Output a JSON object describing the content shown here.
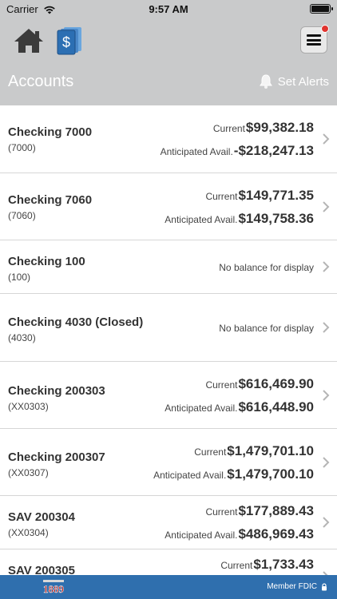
{
  "status": {
    "carrier": "Carrier",
    "time": "9:57 AM"
  },
  "header": {
    "title": "Accounts",
    "set_alerts": "Set Alerts"
  },
  "accounts": [
    {
      "name": "Checking 7000",
      "number": "(7000)",
      "current_label": "Current",
      "current": "$99,382.18",
      "avail_label": "Anticipated Avail.",
      "avail": "-$218,247.13"
    },
    {
      "name": "Checking 7060",
      "number": "(7060)",
      "current_label": "Current",
      "current": "$149,771.35",
      "avail_label": "Anticipated Avail.",
      "avail": "$149,758.36"
    },
    {
      "name": "Checking 100",
      "number": "(100)",
      "no_balance": "No balance for display"
    },
    {
      "name": "Checking 4030 (Closed)",
      "number": "(4030)",
      "no_balance": "No balance for display"
    },
    {
      "name": "Checking 200303",
      "number": "(XX0303)",
      "current_label": "Current",
      "current": "$616,469.90",
      "avail_label": "Anticipated Avail.",
      "avail": "$616,448.90"
    },
    {
      "name": "Checking 200307",
      "number": "(XX0307)",
      "current_label": "Current",
      "current": "$1,479,701.10",
      "avail_label": "Anticipated Avail.",
      "avail": "$1,479,700.10"
    },
    {
      "name": "SAV 200304",
      "number": "(XX0304)",
      "current_label": "Current",
      "current": "$177,889.43",
      "avail_label": "Anticipated Avail.",
      "avail": "$486,969.43"
    },
    {
      "name": "SAV 200305",
      "number": "",
      "current_label": "Current",
      "current": "$1,733.43"
    }
  ],
  "footer": {
    "logo_text": "1889",
    "member_fdic": "Member FDIC"
  },
  "colors": {
    "header_bg": "#c9cacb",
    "footer_bg": "#2f6fae",
    "notification": "#e0342f",
    "money_icon": "#2c6fb3"
  },
  "icons": [
    "home-icon",
    "money-icon",
    "menu-icon",
    "bell-icon",
    "chevron-right-icon",
    "lock-icon",
    "wifi-icon",
    "battery-icon"
  ]
}
